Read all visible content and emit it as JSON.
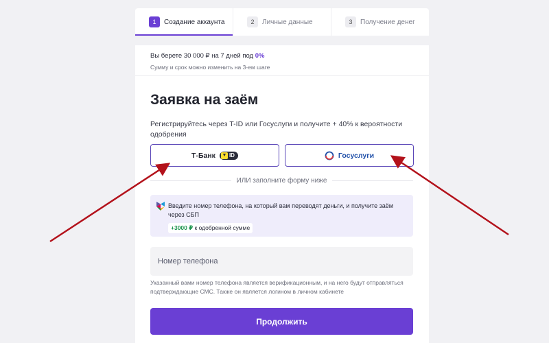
{
  "steps": [
    {
      "num": "1",
      "label": "Создание аккаунта"
    },
    {
      "num": "2",
      "label": "Личные данные"
    },
    {
      "num": "3",
      "label": "Получение денег"
    }
  ],
  "loan": {
    "summary_prefix": "Вы берете 30 000 ₽ на 7 дней под ",
    "rate": "0%",
    "note": "Сумму и срок можно изменить на 3-ем шаге"
  },
  "form": {
    "title": "Заявка на заём",
    "subtitle": "Регистрируйтесь через T-ID или Госуслуги и получите + 40% к вероятности одобрения",
    "tbank_label": "Т-Банк",
    "tid_label": "ID",
    "gosuslugi_label": "Госуслуги",
    "divider_text": "ИЛИ заполните форму ниже",
    "sbp_text": "Введите номер телефона, на который вам переводят деньги, и получите заём через СБП",
    "bonus_amount": "+3000 ₽",
    "bonus_suffix": " к одобренной сумме",
    "phone_placeholder": "Номер телефона",
    "phone_hint": "Указанный вами номер телефона является верификационным, и на него будут отправляться подтверждающие СМС. Также он является логином в личном кабинете",
    "submit_label": "Продолжить"
  },
  "colors": {
    "accent": "#6a3fd4",
    "bonus": "#18924a",
    "arrow": "#b3121b",
    "tid_yellow": "#ffdd2d"
  },
  "icons": [
    "tid-shield-icon",
    "gosuslugi-logo-icon",
    "sbp-logo-icon",
    "red-arrow-left",
    "red-arrow-right"
  ]
}
